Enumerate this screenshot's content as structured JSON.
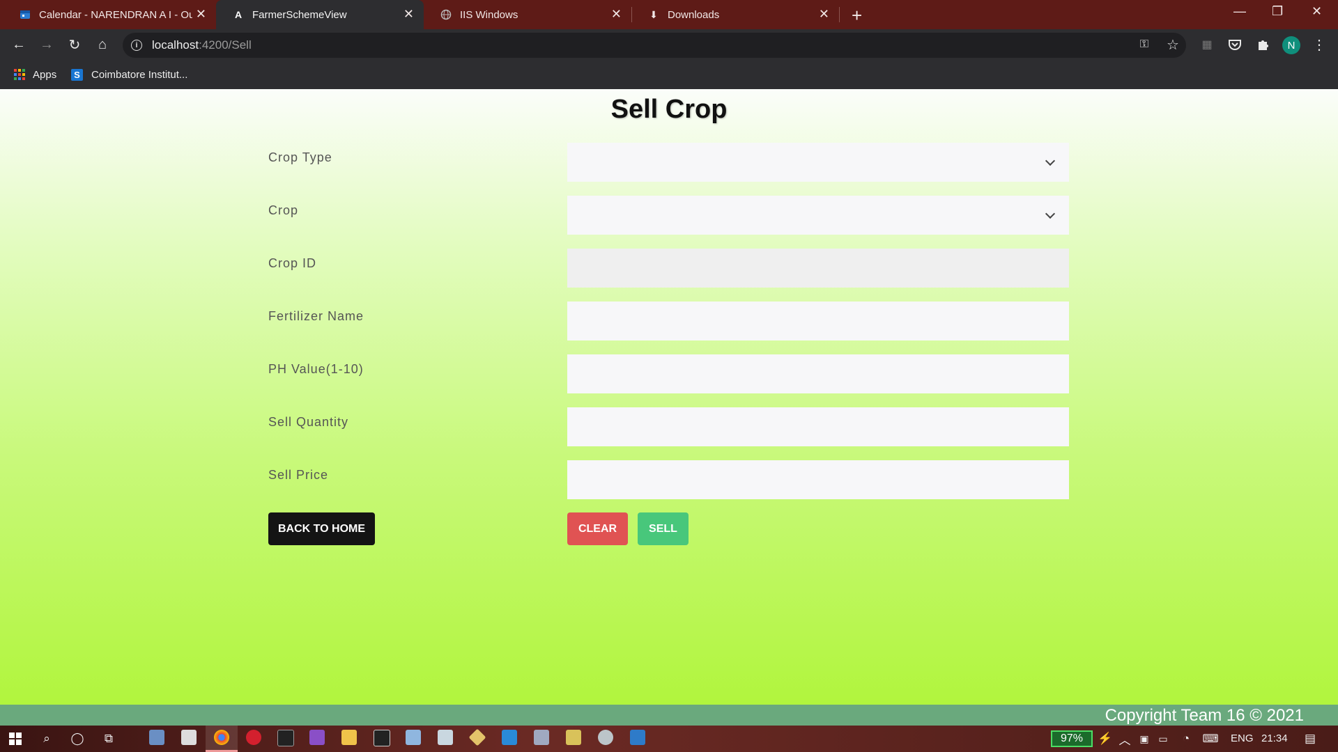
{
  "browser": {
    "tabs": [
      {
        "title": "Calendar - NARENDRAN A I - Ou",
        "icon": "outlook-calendar-icon",
        "active": false
      },
      {
        "title": "FarmerSchemeView",
        "icon": "angular-icon",
        "active": true
      },
      {
        "title": "IIS Windows",
        "icon": "globe-icon",
        "active": false
      },
      {
        "title": "Downloads",
        "icon": "download-icon",
        "active": false
      }
    ],
    "url_host": "localhost",
    "url_rest": ":4200/Sell",
    "profile_initial": "N",
    "bookmarks": [
      {
        "label": "Apps",
        "icon": "apps-grid-icon"
      },
      {
        "label": "Coimbatore Institut...",
        "icon": "s-logo-icon"
      }
    ]
  },
  "page": {
    "title": "Sell Crop",
    "fields": [
      {
        "label": "Crop Type",
        "type": "select",
        "value": ""
      },
      {
        "label": "Crop",
        "type": "select",
        "value": ""
      },
      {
        "label": "Crop ID",
        "type": "text-disabled",
        "value": ""
      },
      {
        "label": "Fertilizer Name",
        "type": "text",
        "value": ""
      },
      {
        "label": "PH Value(1-10)",
        "type": "text",
        "value": ""
      },
      {
        "label": "Sell Quantity",
        "type": "text",
        "value": ""
      },
      {
        "label": "Sell Price",
        "type": "text",
        "value": ""
      }
    ],
    "buttons": {
      "back_home": "BACK TO HOME",
      "clear": "CLEAR",
      "sell": "SELL"
    },
    "footer": "Copyright Team 16 © 2021",
    "colors": {
      "clear_button": "#e05353",
      "sell_button": "#48c77b",
      "back_button": "#141414",
      "footer": "#6aa97d"
    }
  },
  "taskbar": {
    "battery": "97%",
    "language": "ENG",
    "time": "21:34"
  }
}
